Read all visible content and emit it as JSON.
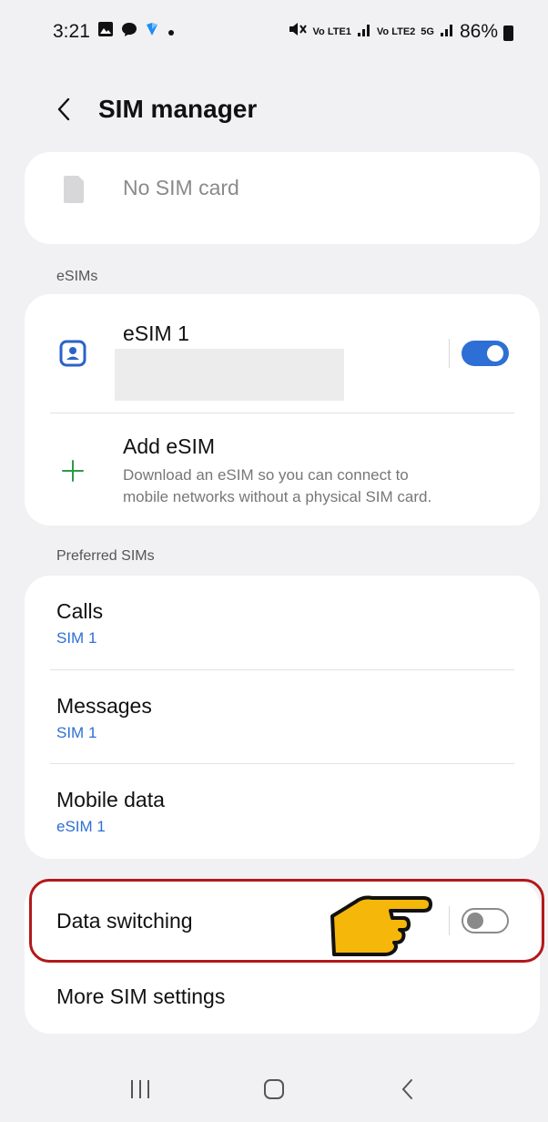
{
  "status_bar": {
    "time": "3:21",
    "battery_percent": "86%",
    "volte1": "Vo LTE1",
    "volte2": "Vo LTE2",
    "net": "5G"
  },
  "header": {
    "title": "SIM manager"
  },
  "physical_sim": {
    "label": "No SIM card"
  },
  "esims_section": {
    "label": "eSIMs",
    "esim1_name": "eSIM 1",
    "esim1_enabled": true,
    "add_title": "Add eSIM",
    "add_description_line1": "Download an eSIM so you can connect to",
    "add_description_line2": "mobile networks without a physical SIM card."
  },
  "preferred_section": {
    "label": "Preferred SIMs",
    "items": [
      {
        "title": "Calls",
        "value": "SIM 1"
      },
      {
        "title": "Messages",
        "value": "SIM 1"
      },
      {
        "title": "Mobile data",
        "value": "eSIM 1"
      }
    ]
  },
  "bottom_card": {
    "data_switching_label": "Data switching",
    "data_switching_enabled": false,
    "more_settings_label": "More SIM settings"
  },
  "colors": {
    "accent": "#2e6fd6",
    "highlight_border": "#b3181a",
    "pointer_fill": "#f5b70a"
  },
  "icons": {
    "back": "chevron-left-icon",
    "sim": "sim-card-icon",
    "esim": "esim-profile-icon",
    "add": "plus-icon",
    "pointer": "pointing-hand-icon"
  }
}
